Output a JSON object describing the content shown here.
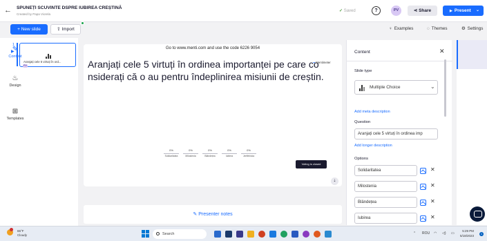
{
  "header": {
    "title": "SPUNEȚI SCUVINTE DSPRE IUBIREA CREȘTINĂ",
    "subtitle": "Created by Papa Viorela",
    "saved": "Saved",
    "avatar": "PV",
    "share": "Share",
    "present": "Present"
  },
  "toolbar": {
    "new_slide": "+ New slide",
    "import": "Import",
    "examples": "Examples",
    "themes": "Themes",
    "settings": "Settings"
  },
  "slides_panel": {
    "slide_number": "1",
    "thumbnail_text": "Aranjați cele 5 virtuți în ord...",
    "thumbnail_avatar": "PV"
  },
  "slide": {
    "join_text": "Go to www.menti.com and use the code 6226 9054",
    "question": "Aranjați cele 5 virtuți în ordinea importanței pe care co nsiderați că o au pentru îndeplinirea misiunii de creștin.",
    "brand": "Mentimeter",
    "votes_button": "Voting is closed",
    "results": [
      {
        "label": "Solidaritatea",
        "value": "0%"
      },
      {
        "label": "Milostenia",
        "value": "0%"
      },
      {
        "label": "Blândețea",
        "value": "0%"
      },
      {
        "label": "Iubirea",
        "value": "0%"
      },
      {
        "label": "Jertfelnicia",
        "value": "0%"
      }
    ]
  },
  "notes": {
    "label": "Presenter notes"
  },
  "content_panel": {
    "heading": "Content",
    "slide_type_label": "Slide type",
    "slide_type": "Multiple Choice",
    "add_meta": "Add meta description",
    "question_label": "Question",
    "question_value": "Aranjați cele 5 virtuți în ordinea imp",
    "add_longer": "Add longer description",
    "options_label": "Options",
    "options": [
      "Solidaritatea",
      "Milostenia",
      "Blândețea",
      "Iubirea"
    ]
  },
  "side_tabs": {
    "content": "Content",
    "design": "Design",
    "templates": "Templates"
  },
  "taskbar": {
    "weather_temp": "65°F",
    "weather_desc": "Cloudy",
    "search": "Search",
    "lang": "ROU",
    "time": "5:29 PM",
    "date": "5/18/2023",
    "notif": "1"
  }
}
